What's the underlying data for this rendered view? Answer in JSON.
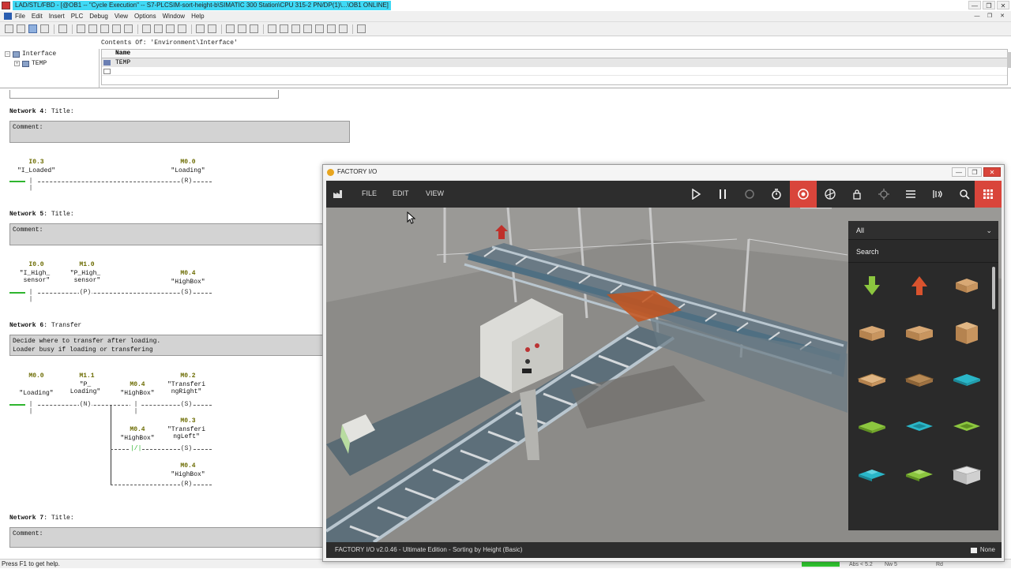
{
  "window": {
    "title": "LAD/STL/FBD - [@OB1 -- \"Cycle Execution\" -- S7-PLCSIM-sort-height-b\\SIMATIC 300 Station\\CPU 315-2 PN/DP(1)\\...\\OB1 ONLINE]",
    "min": "—",
    "max": "❐",
    "close": "✕"
  },
  "menu": [
    "File",
    "Edit",
    "Insert",
    "PLC",
    "Debug",
    "View",
    "Options",
    "Window",
    "Help"
  ],
  "interface": {
    "contents_label": "Contents Of: 'Environment\\Interface'",
    "tree_root": "Interface",
    "tree_child": "TEMP",
    "column_name": "Name",
    "row_1": "TEMP"
  },
  "networks": {
    "n4": {
      "label": "Network 4",
      "title": ": Title:",
      "comment": "Comment:"
    },
    "n5": {
      "label": "Network 5",
      "title": ": Title:",
      "comment": "Comment:"
    },
    "n6": {
      "label": "Network 6",
      "title": ": Transfer",
      "comment": "Decide where to transfer after loading.\nLoader busy if loading or transfering"
    },
    "n7": {
      "label": "Network 7",
      "title": ": Title:",
      "comment": "Comment:"
    }
  },
  "ladder": {
    "n4_in_addr": "I0.3",
    "n4_in_sym": "\"I_Loaded\"",
    "n4_out_addr": "M0.0",
    "n4_out_sym": "\"Loading\"",
    "n4_coil": "R",
    "n5_in1_addr": "I0.0",
    "n5_in1_sym": "\"I_High_\n sensor\"",
    "n5_in2_addr": "M1.0",
    "n5_in2_sym": "\"P_High_\n sensor\"",
    "n5_p": "P",
    "n5_out_addr": "M0.4",
    "n5_out_sym": "\"HighBox\"",
    "n5_coil": "S",
    "n6_c1_addr": "M0.0",
    "n6_c1_sym": "\"Loading\"",
    "n6_c2_addr": "M1.1",
    "n6_c2_sym": "\"P_\nLoading\"",
    "n6_n": "N",
    "n6_c3_addr": "M0.4",
    "n6_c3_sym": "\"HighBox\"",
    "n6_o1_addr": "M0.2",
    "n6_o1_sym": "\"Transferi\nngRight\"",
    "n6_o1_coil": "S",
    "n6_c4_addr": "M0.4",
    "n6_c4_sym": "\"HighBox\"",
    "n6_o2_addr": "M0.3",
    "n6_o2_sym": "\"Transferi\nngLeft\"",
    "n6_o2_coil": "S",
    "n6_o3_addr": "M0.4",
    "n6_o3_sym": "\"HighBox\"",
    "n6_o3_coil": "R"
  },
  "status": {
    "hint": "Press F1 to get help.",
    "right_a": "Abs < 5.2",
    "right_b": "Nw 5",
    "right_c": "Rd"
  },
  "factoryio": {
    "title": "FACTORY I/O",
    "menu": [
      "FILE",
      "EDIT",
      "VIEW"
    ],
    "toolbar_icons": [
      "play-icon",
      "pause-icon",
      "reset-icon",
      "timer-icon",
      "camera-orbit-icon",
      "fly-camera-icon",
      "first-person-icon",
      "target-icon",
      "list-icon",
      "sensor-icon",
      "drivers-icon",
      "palette-grid-icon"
    ],
    "version": "FACTORY I/O v2.0.46 - Ultimate Edition - Sorting by Height (Basic)",
    "none_label": "None",
    "palette": {
      "filter": "All",
      "search": "Search",
      "chevron": "⌄"
    },
    "colors": {
      "bar": "#2d2d2d",
      "accent_red": "#d9453b",
      "palette_bg": "#2a2a2a"
    }
  }
}
